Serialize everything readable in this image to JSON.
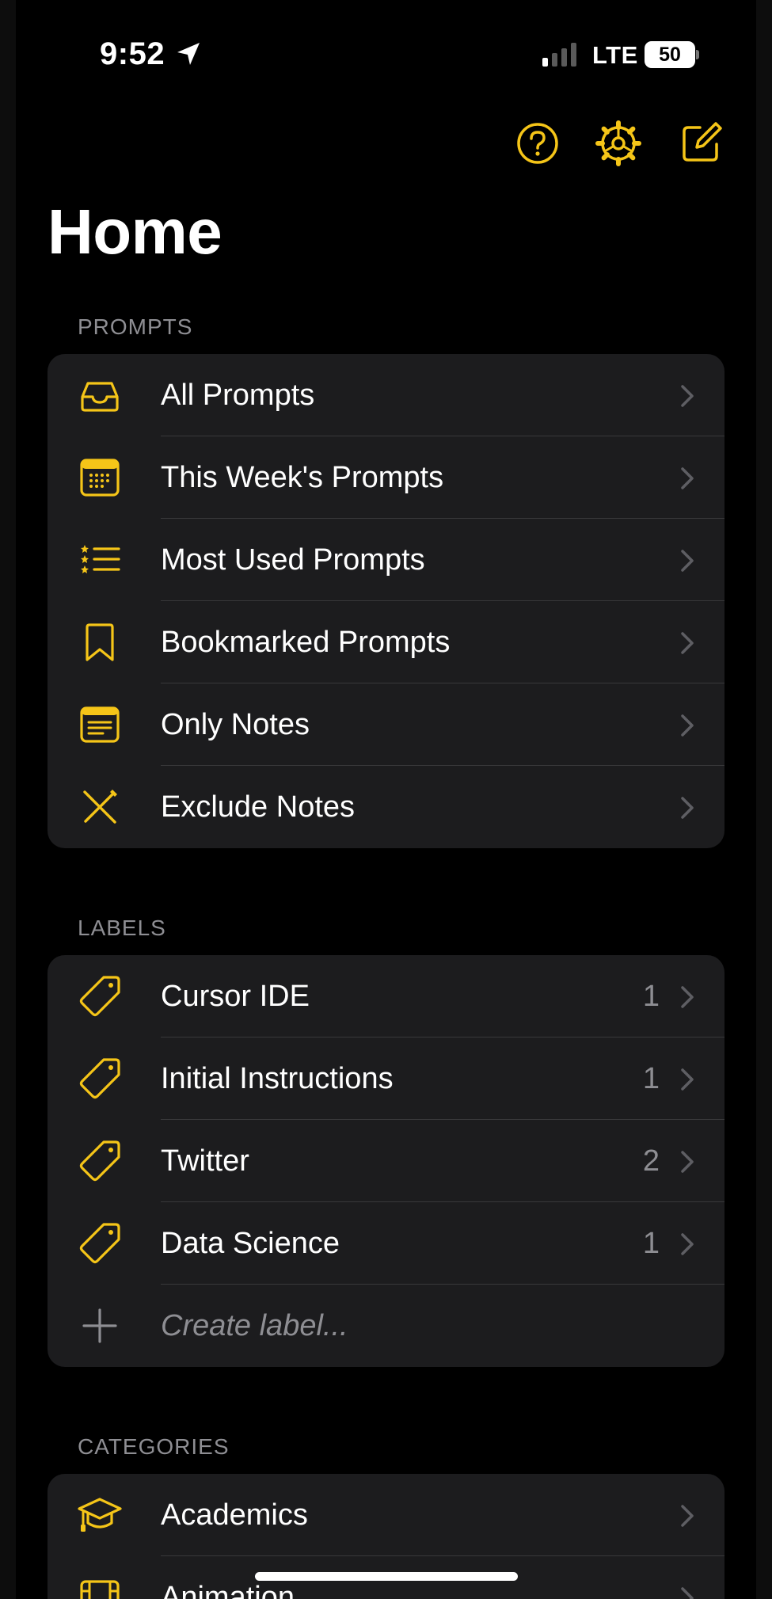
{
  "status_bar": {
    "time": "9:52",
    "network": "LTE",
    "battery": "50"
  },
  "toolbar": {
    "help_icon": "question-circle-icon",
    "settings_icon": "gear-icon",
    "compose_icon": "compose-icon"
  },
  "page_title": "Home",
  "accent_color": "#f5c518",
  "sections": {
    "prompts": {
      "header": "PROMPTS",
      "items": [
        {
          "label": "All Prompts",
          "icon": "tray-icon"
        },
        {
          "label": "This Week's Prompts",
          "icon": "calendar-icon"
        },
        {
          "label": "Most Used Prompts",
          "icon": "starred-list-icon"
        },
        {
          "label": "Bookmarked Prompts",
          "icon": "bookmark-icon"
        },
        {
          "label": "Only Notes",
          "icon": "note-icon"
        },
        {
          "label": "Exclude Notes",
          "icon": "pencil-cross-icon"
        }
      ]
    },
    "labels": {
      "header": "LABELS",
      "items": [
        {
          "label": "Cursor IDE",
          "count": "1",
          "icon": "tag-icon"
        },
        {
          "label": "Initial Instructions",
          "count": "1",
          "icon": "tag-icon"
        },
        {
          "label": "Twitter",
          "count": "2",
          "icon": "tag-icon"
        },
        {
          "label": "Data Science",
          "count": "1",
          "icon": "tag-icon"
        }
      ],
      "create_placeholder": "Create label..."
    },
    "categories": {
      "header": "CATEGORIES",
      "items": [
        {
          "label": "Academics",
          "icon": "graduation-cap-icon"
        },
        {
          "label": "Animation",
          "icon": "film-icon"
        }
      ]
    }
  }
}
